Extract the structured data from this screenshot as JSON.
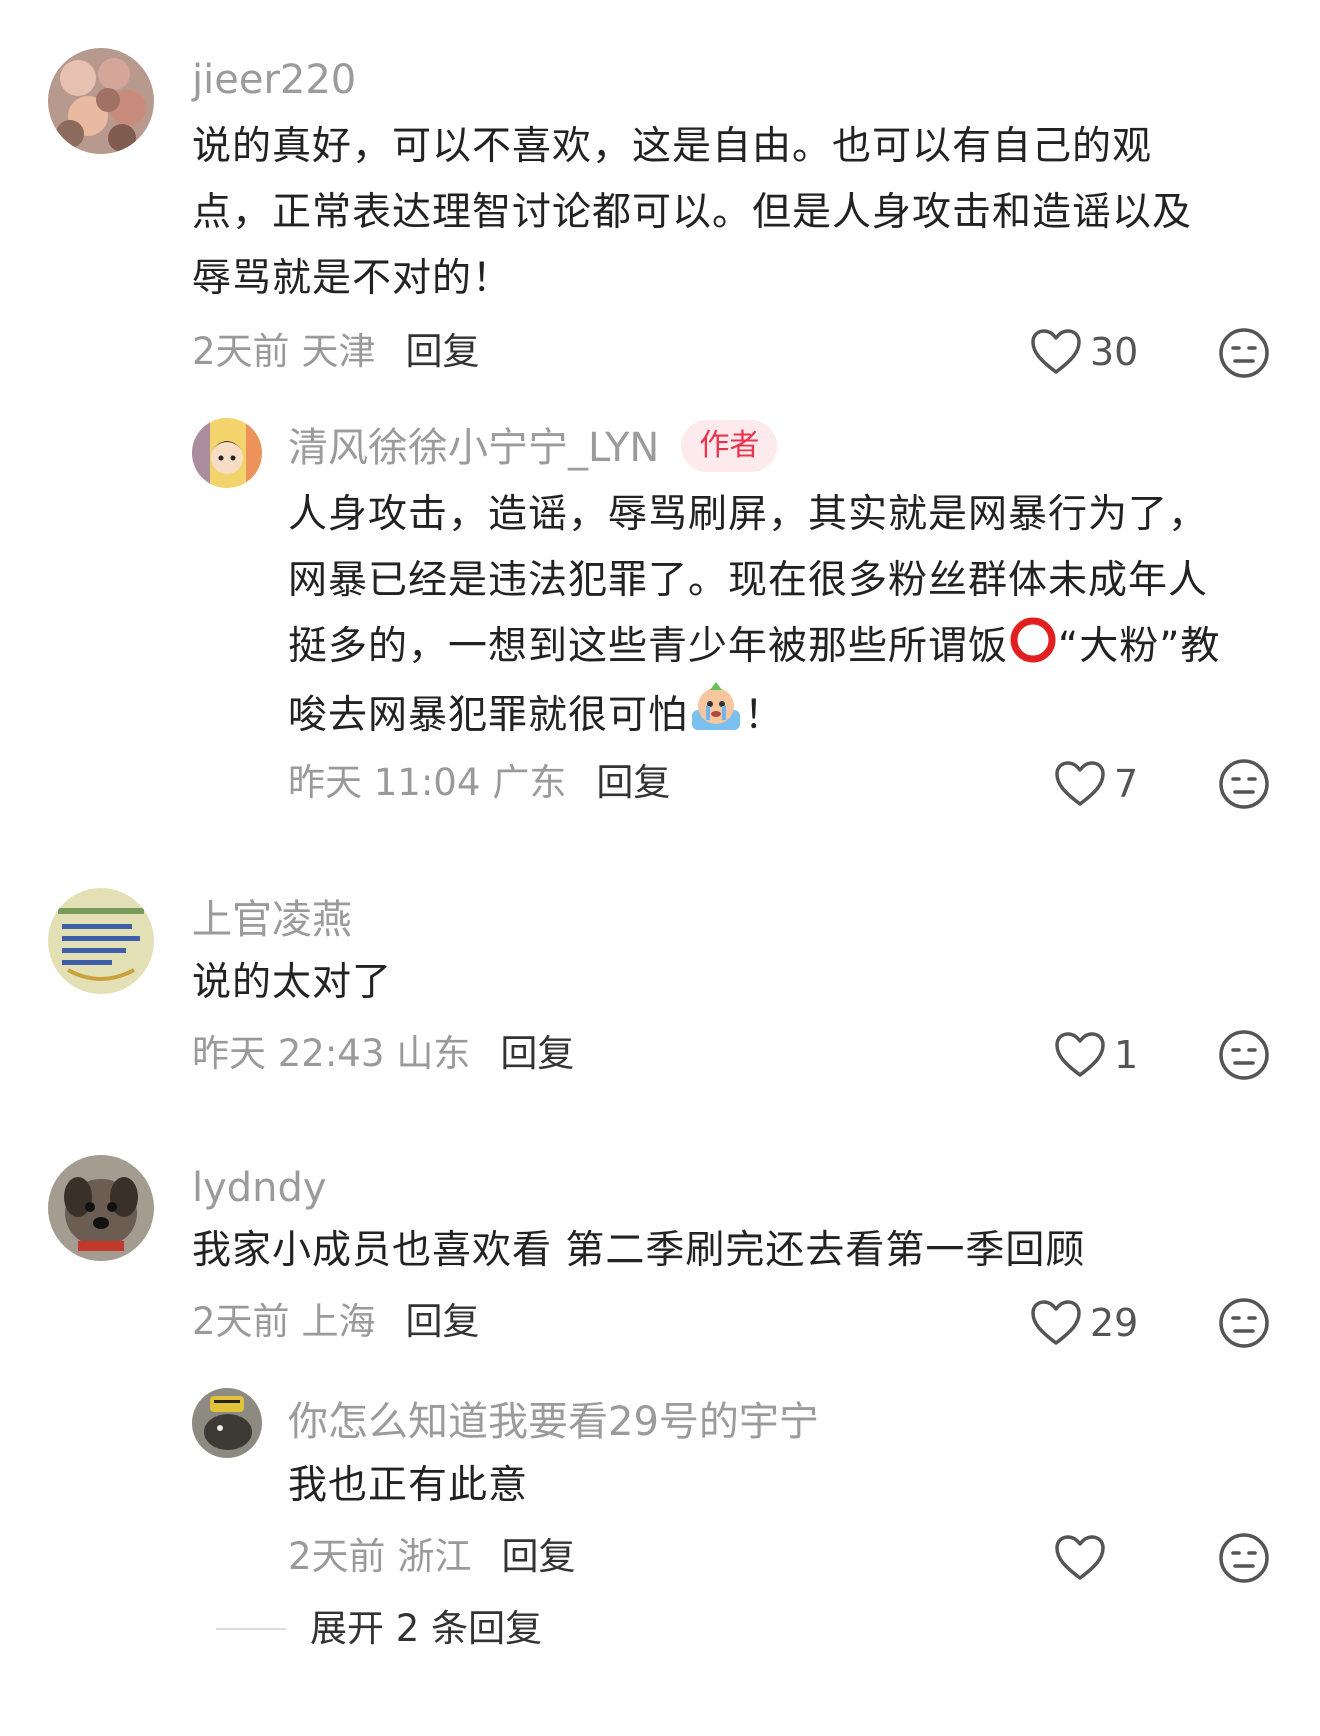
{
  "comments": [
    {
      "username": "jieer220",
      "text_lines": [
        "说的真好，可以不喜欢，这是自由。也可以有自己的观",
        "点，正常表达理智讨论都可以。但是人身攻击和造谣以及",
        "辱骂就是不对的！"
      ],
      "time": "2天前",
      "location": "天津",
      "reply_label": "回复",
      "likes": "30",
      "replies": [
        {
          "username": "清风徐徐小宁宁_LYN",
          "badge": "作者",
          "text_lines": [
            "人身攻击，造谣，辱骂刷屏，其实就是网暴行为了，",
            "网暴已经是违法犯罪了。现在很多粉丝群体未成年人",
            "挺多的，一想到这些青少年被那些所谓饭",
            "“大粉”教",
            "唆去网暴犯罪就很可怕",
            "！"
          ],
          "time": "昨天 11:04",
          "location": "广东",
          "reply_label": "回复",
          "likes": "7"
        }
      ]
    },
    {
      "username": "上官凌燕",
      "text_lines": [
        "说的太对了"
      ],
      "time": "昨天 22:43",
      "location": "山东",
      "reply_label": "回复",
      "likes": "1"
    },
    {
      "username": "lydndy",
      "text_lines": [
        "我家小成员也喜欢看 第二季刷完还去看第一季回顾"
      ],
      "time": "2天前",
      "location": "上海",
      "reply_label": "回复",
      "likes": "29",
      "replies": [
        {
          "username": "你怎么知道我要看29号的宇宁",
          "text_lines": [
            "我也正有此意"
          ],
          "time": "2天前",
          "location": "浙江",
          "reply_label": "回复",
          "likes": ""
        }
      ],
      "expand_label": "展开 2 条回复"
    }
  ],
  "colors": {
    "badge_bg": "#fdeaec",
    "badge_text": "#e8324e",
    "username": "#9b9b9b",
    "meta": "#9a9a9a"
  },
  "icons": [
    "heart-outline-icon",
    "meh-face-icon",
    "red-circle-emoji",
    "crying-emoji"
  ]
}
